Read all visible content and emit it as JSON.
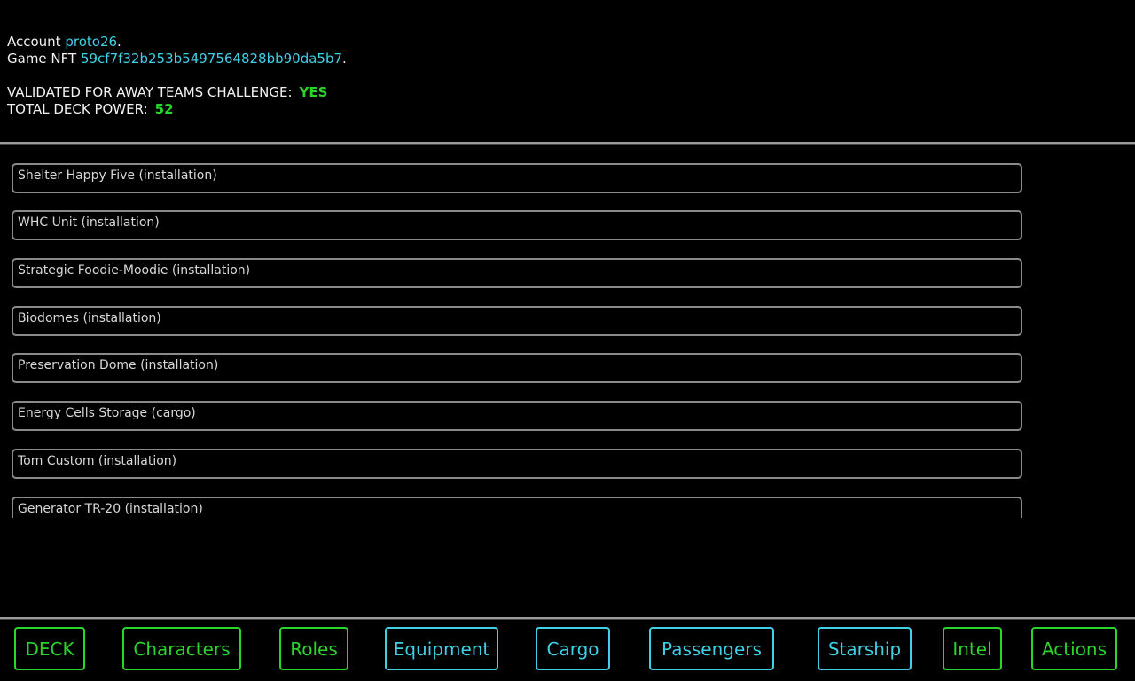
{
  "account": {
    "label": "Account",
    "name": "proto26",
    "period": "."
  },
  "game_nft": {
    "label": "Game NFT",
    "id": "59cf7f32b253b5497564828bb90da5b7",
    "period": "."
  },
  "validation": {
    "label": "VALIDATED FOR AWAY TEAMS CHALLENGE:",
    "value": "YES"
  },
  "deck_power": {
    "label": "TOTAL DECK POWER:",
    "value": "52"
  },
  "items": [
    "Shelter Happy Five (installation)",
    "WHC Unit (installation)",
    "Strategic Foodie-Moodie (installation)",
    "Biodomes (installation)",
    "Preservation Dome (installation)",
    "Energy Cells Storage (cargo)",
    "Tom Custom (installation)",
    "Generator TR-20 (installation)"
  ],
  "nav": [
    {
      "label": "DECK",
      "color": "green"
    },
    {
      "label": "Characters",
      "color": "green"
    },
    {
      "label": "Roles",
      "color": "green"
    },
    {
      "label": "Equipment",
      "color": "cyan"
    },
    {
      "label": "Cargo",
      "color": "cyan"
    },
    {
      "label": "Passengers",
      "color": "cyan"
    },
    {
      "label": "Starship",
      "color": "cyan"
    },
    {
      "label": "Intel",
      "color": "green"
    },
    {
      "label": "Actions",
      "color": "green"
    }
  ],
  "colors": {
    "green": "#2bd42b",
    "cyan": "#3fd0e6",
    "border": "#8a8a8a",
    "background": "#000000"
  }
}
